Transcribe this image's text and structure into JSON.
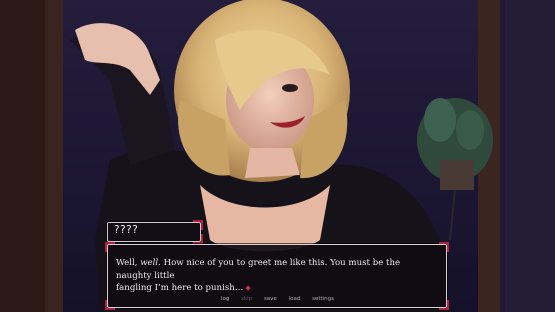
{
  "speaker": {
    "name": "????"
  },
  "dialogue": {
    "line1_a": "Well, ",
    "line1_em": "well.",
    "line1_b": " How nice of you to greet me like this. You must be the naughty little",
    "line2": "fangling I’m here to punish…",
    "continue_mark": "◆"
  },
  "menu": {
    "items": [
      "log",
      "skip",
      "save",
      "load",
      "settings"
    ]
  },
  "colors": {
    "accent": "#b0213e",
    "box_bg": "#100c12",
    "text": "#efe9ec",
    "bg_night": "#1a1530"
  }
}
